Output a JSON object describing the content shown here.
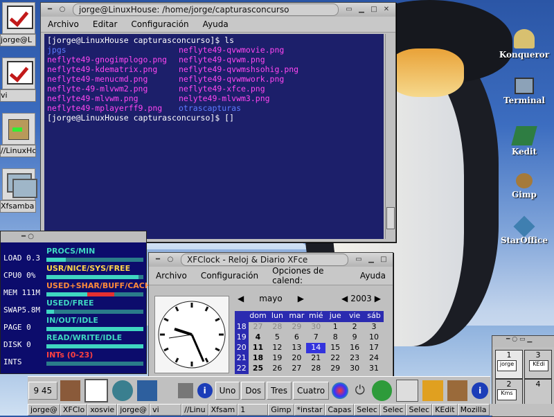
{
  "desktop": {
    "launchers": [
      {
        "label": "jorge@L",
        "icon": "check-icon"
      },
      {
        "label": "vi",
        "icon": "check-icon"
      },
      {
        "label": "//LinuxHo",
        "icon": "file-manager-icon"
      },
      {
        "label": "Xfsamba",
        "icon": "network-icon"
      }
    ],
    "icons": [
      {
        "label": "Konqueror",
        "icon": "konqueror-icon"
      },
      {
        "label": "Terminal",
        "icon": "terminal-icon"
      },
      {
        "label": "Kedit",
        "icon": "kedit-icon"
      },
      {
        "label": "Gimp",
        "icon": "gimp-icon"
      },
      {
        "label": "StarOffice",
        "icon": "staroffice-icon"
      }
    ]
  },
  "terminal": {
    "title": "jorge@LinuxHouse: /home/jorge/capturasconcurso",
    "menu": [
      "Archivo",
      "Editar",
      "Configuración",
      "Ayuda"
    ],
    "prompt1": "[jorge@LinuxHouse capturasconcurso]$ ls",
    "rows": [
      [
        "jpgs",
        "neflyte49-qvwmovie.png"
      ],
      [
        "neflyte49-gnogimplogo.png",
        "neflyte49-qvwm.png"
      ],
      [
        "neflyte49-kdematrix.png",
        "neflyte49-qvwmshsohig.png"
      ],
      [
        "neflyte49-menucmd.png",
        "neflyte49-qvwmwork.png"
      ],
      [
        "neflyte-49-mlvwm2.png",
        "neflyte49-xfce.png"
      ],
      [
        "neflyte49-mlvwm.png",
        "nelyte49-mlvwm3.png"
      ],
      [
        "neflyte49-mplayerff9.png",
        "otrascapturas"
      ]
    ],
    "prompt2": "[jorge@LinuxHouse capturasconcurso]$ []"
  },
  "monitor": {
    "rows": [
      {
        "name": "LOAD",
        "value": "0.3",
        "label": "PROCS/MIN"
      },
      {
        "name": "CPU0",
        "value": "0%",
        "label": "USR/NICE/SYS/FREE"
      },
      {
        "name": "MEM",
        "value": "111M",
        "label": "USED+SHAR/BUFF/CACHE"
      },
      {
        "name": "SWAP",
        "value": "5.8M",
        "label": "USED/FREE"
      },
      {
        "name": "PAGE",
        "value": "0",
        "label": "IN/OUT/IDLE"
      },
      {
        "name": "DISK",
        "value": "0",
        "label": "READ/WRITE/IDLE"
      },
      {
        "name": "INTS",
        "value": "",
        "label": "INTs (0-23)"
      }
    ]
  },
  "xfclock": {
    "title": "XFClock - Reloj & Diario XFce",
    "menu": [
      "Archivo",
      "Configuración",
      "Opciones de calend:",
      "Ayuda"
    ],
    "month": "mayo",
    "year": "2003",
    "days": [
      "dom",
      "lun",
      "mar",
      "mié",
      "jue",
      "vie",
      "sáb"
    ],
    "weeks": [
      {
        "wk": "18",
        "days": [
          "27",
          "28",
          "29",
          "30",
          "1",
          "2",
          "3"
        ]
      },
      {
        "wk": "19",
        "days": [
          "4",
          "5",
          "6",
          "7",
          "8",
          "9",
          "10"
        ]
      },
      {
        "wk": "20",
        "days": [
          "11",
          "12",
          "13",
          "14",
          "15",
          "16",
          "17"
        ]
      },
      {
        "wk": "21",
        "days": [
          "18",
          "19",
          "20",
          "21",
          "22",
          "23",
          "24"
        ]
      },
      {
        "wk": "22",
        "days": [
          "25",
          "26",
          "27",
          "28",
          "29",
          "30",
          "31"
        ]
      }
    ]
  },
  "panel": {
    "time": "9 45",
    "desks": [
      "Uno",
      "Dos",
      "Tres",
      "Cuatro"
    ]
  },
  "tasks": [
    "jorge@",
    "XFClo",
    "xosvie",
    "jorge@",
    "vi",
    "//Linu",
    "Xfsam",
    "1",
    "Gimp",
    "*instar",
    "Capas",
    "Selec",
    "Selec",
    "Selec",
    "KEdit",
    "Mozilla"
  ],
  "pager": {
    "cells": [
      "1",
      "3",
      "2",
      "4"
    ],
    "mini": [
      "jorge",
      "KEdi",
      "Kms"
    ]
  }
}
